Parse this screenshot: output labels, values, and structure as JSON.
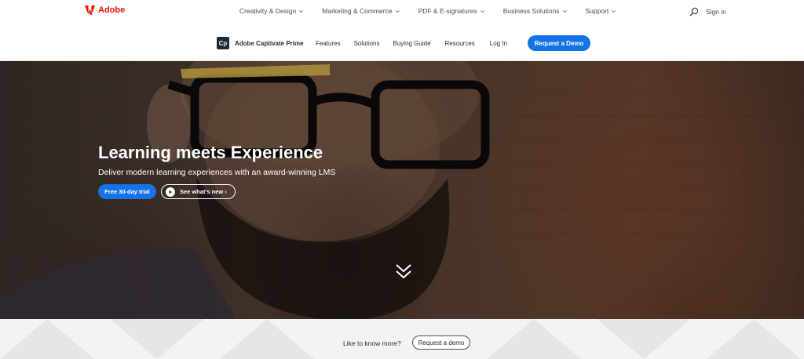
{
  "global_nav": {
    "logo_text": "Adobe",
    "items": [
      {
        "label": "Creativity & Design"
      },
      {
        "label": "Marketing & Commerce"
      },
      {
        "label": "PDF & E-signatures"
      },
      {
        "label": "Business Solutions"
      },
      {
        "label": "Support"
      }
    ],
    "search_icon": "search-icon",
    "signin_label": "Sign in"
  },
  "local_nav": {
    "product_icon_text": "Cp",
    "product_name": "Adobe Captivate Prime",
    "items": [
      {
        "label": "Features"
      },
      {
        "label": "Solutions"
      },
      {
        "label": "Buying Guide"
      },
      {
        "label": "Resources"
      },
      {
        "label": "Log In"
      }
    ],
    "cta_label": "Request a Demo"
  },
  "hero": {
    "title": "Learning meets Experience",
    "subtitle": "Deliver modern learning experiences with an award-winning LMS",
    "primary_cta": "Free 30-day trial",
    "secondary_cta": "See what’s new ›",
    "scroll_icon": "double-chevron-down-icon"
  },
  "contact_strip": {
    "prompt": "Like to know more?",
    "cta_label": "Request a demo"
  },
  "colors": {
    "adobe_red": "#eb1000",
    "accent_blue": "#1473e6"
  }
}
